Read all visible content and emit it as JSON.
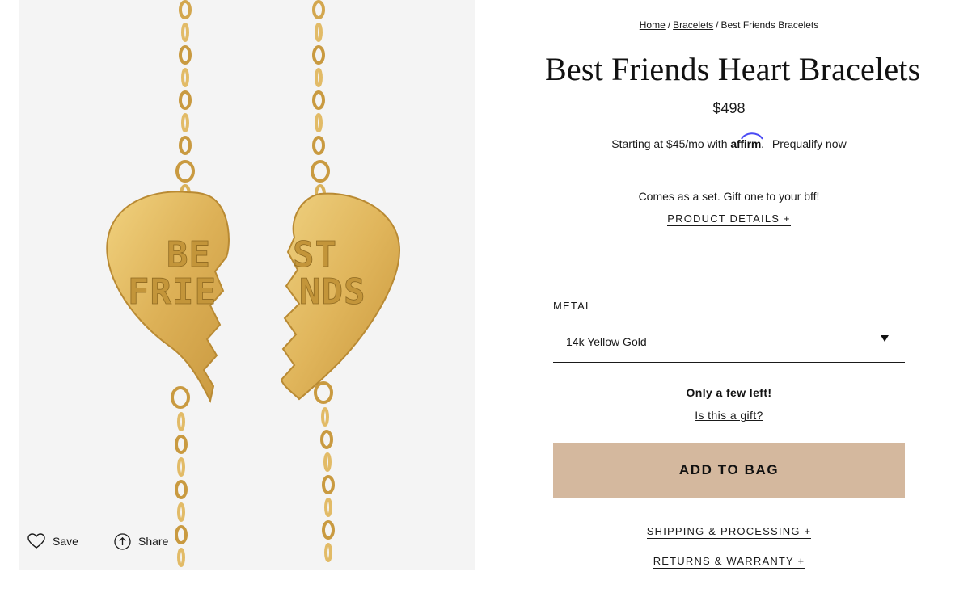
{
  "gallery": {
    "image": {
      "subject": "gold heart split bracelets",
      "left_text_line1": "BE",
      "left_text_line2": "FRIE",
      "right_text_line1": "ST",
      "right_text_line2": "NDS"
    },
    "save_label": "Save",
    "share_label": "Share",
    "save_icon": "heart-outline-icon",
    "share_icon": "share-up-arrow-icon"
  },
  "breadcrumb": {
    "home": "Home",
    "separator": "/",
    "category": "Bracelets",
    "current": "Best Friends Bracelets"
  },
  "product": {
    "title": "Best Friends Heart Bracelets",
    "price": "$498",
    "set_note": "Comes as a set. Gift one to your bff!",
    "details_link": "PRODUCT DETAILS +"
  },
  "financing": {
    "prefix": "Starting at $45/mo with",
    "brand": "affirm",
    "suffix": ".",
    "prequalify_link": "Prequalify now"
  },
  "options": {
    "metal_label": "METAL",
    "metal_selected": "14k Yellow Gold"
  },
  "stock": {
    "note": "Only a few left!",
    "gift_link": "Is this a gift?"
  },
  "cta": {
    "add_to_bag": "ADD TO BAG"
  },
  "accordions": {
    "shipping": "SHIPPING & PROCESSING +",
    "returns": "RETURNS & WARRANTY +"
  },
  "colors": {
    "button_bg": "#d4b89e",
    "gold": "#d9ad4e",
    "image_bg": "#f4f4f4",
    "affirm_blue": "#4a4af4"
  }
}
